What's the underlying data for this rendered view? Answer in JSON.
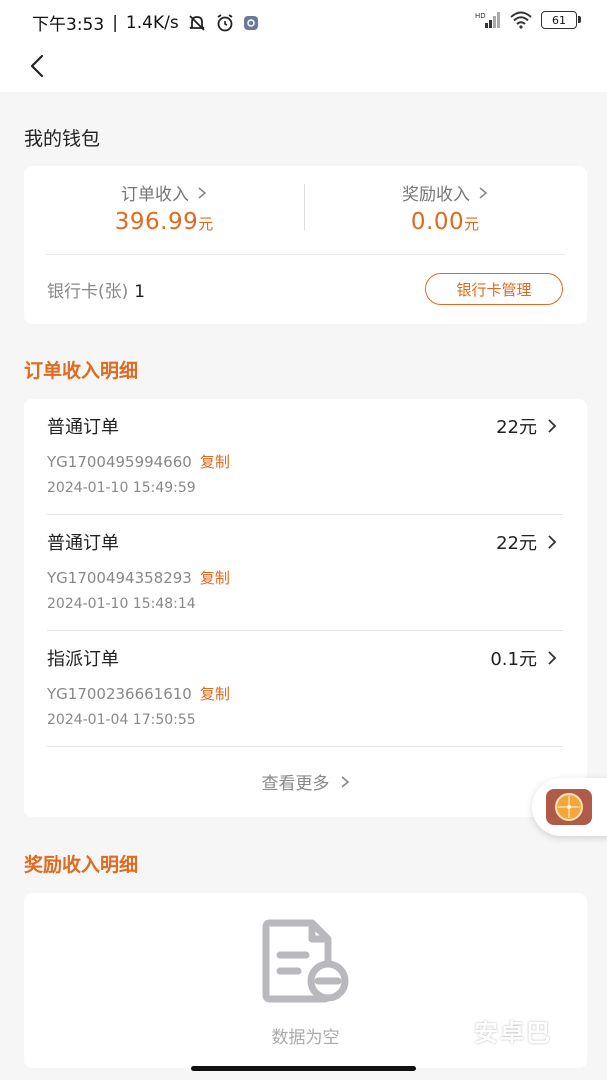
{
  "status": {
    "time": "下午3:53",
    "network_speed": "1.4K/s",
    "battery": "61"
  },
  "wallet": {
    "title": "我的钱包",
    "order_income_label": "订单收入",
    "order_income_value": "396.99",
    "order_income_unit": "元",
    "reward_income_label": "奖励收入",
    "reward_income_value": "0.00",
    "reward_income_unit": "元",
    "bank_card_label": "银行卡(张)",
    "bank_card_count": "1",
    "bank_card_manage": "银行卡管理"
  },
  "orders_section": {
    "title": "订单收入明细",
    "copy_label": "复制",
    "more_label": "查看更多",
    "items": [
      {
        "type": "普通订单",
        "amount": "22元",
        "id": "YG1700495994660",
        "time": "2024-01-10 15:49:59"
      },
      {
        "type": "普通订单",
        "amount": "22元",
        "id": "YG1700494358293",
        "time": "2024-01-10 15:48:14"
      },
      {
        "type": "指派订单",
        "amount": "0.1元",
        "id": "YG1700236661610",
        "time": "2024-01-04 17:50:55"
      }
    ]
  },
  "reward_section": {
    "title": "奖励收入明细",
    "empty_text": "数据为空"
  },
  "watermark": "安卓巴",
  "colors": {
    "accent": "#e06a1f",
    "background": "#f6f6f6"
  }
}
